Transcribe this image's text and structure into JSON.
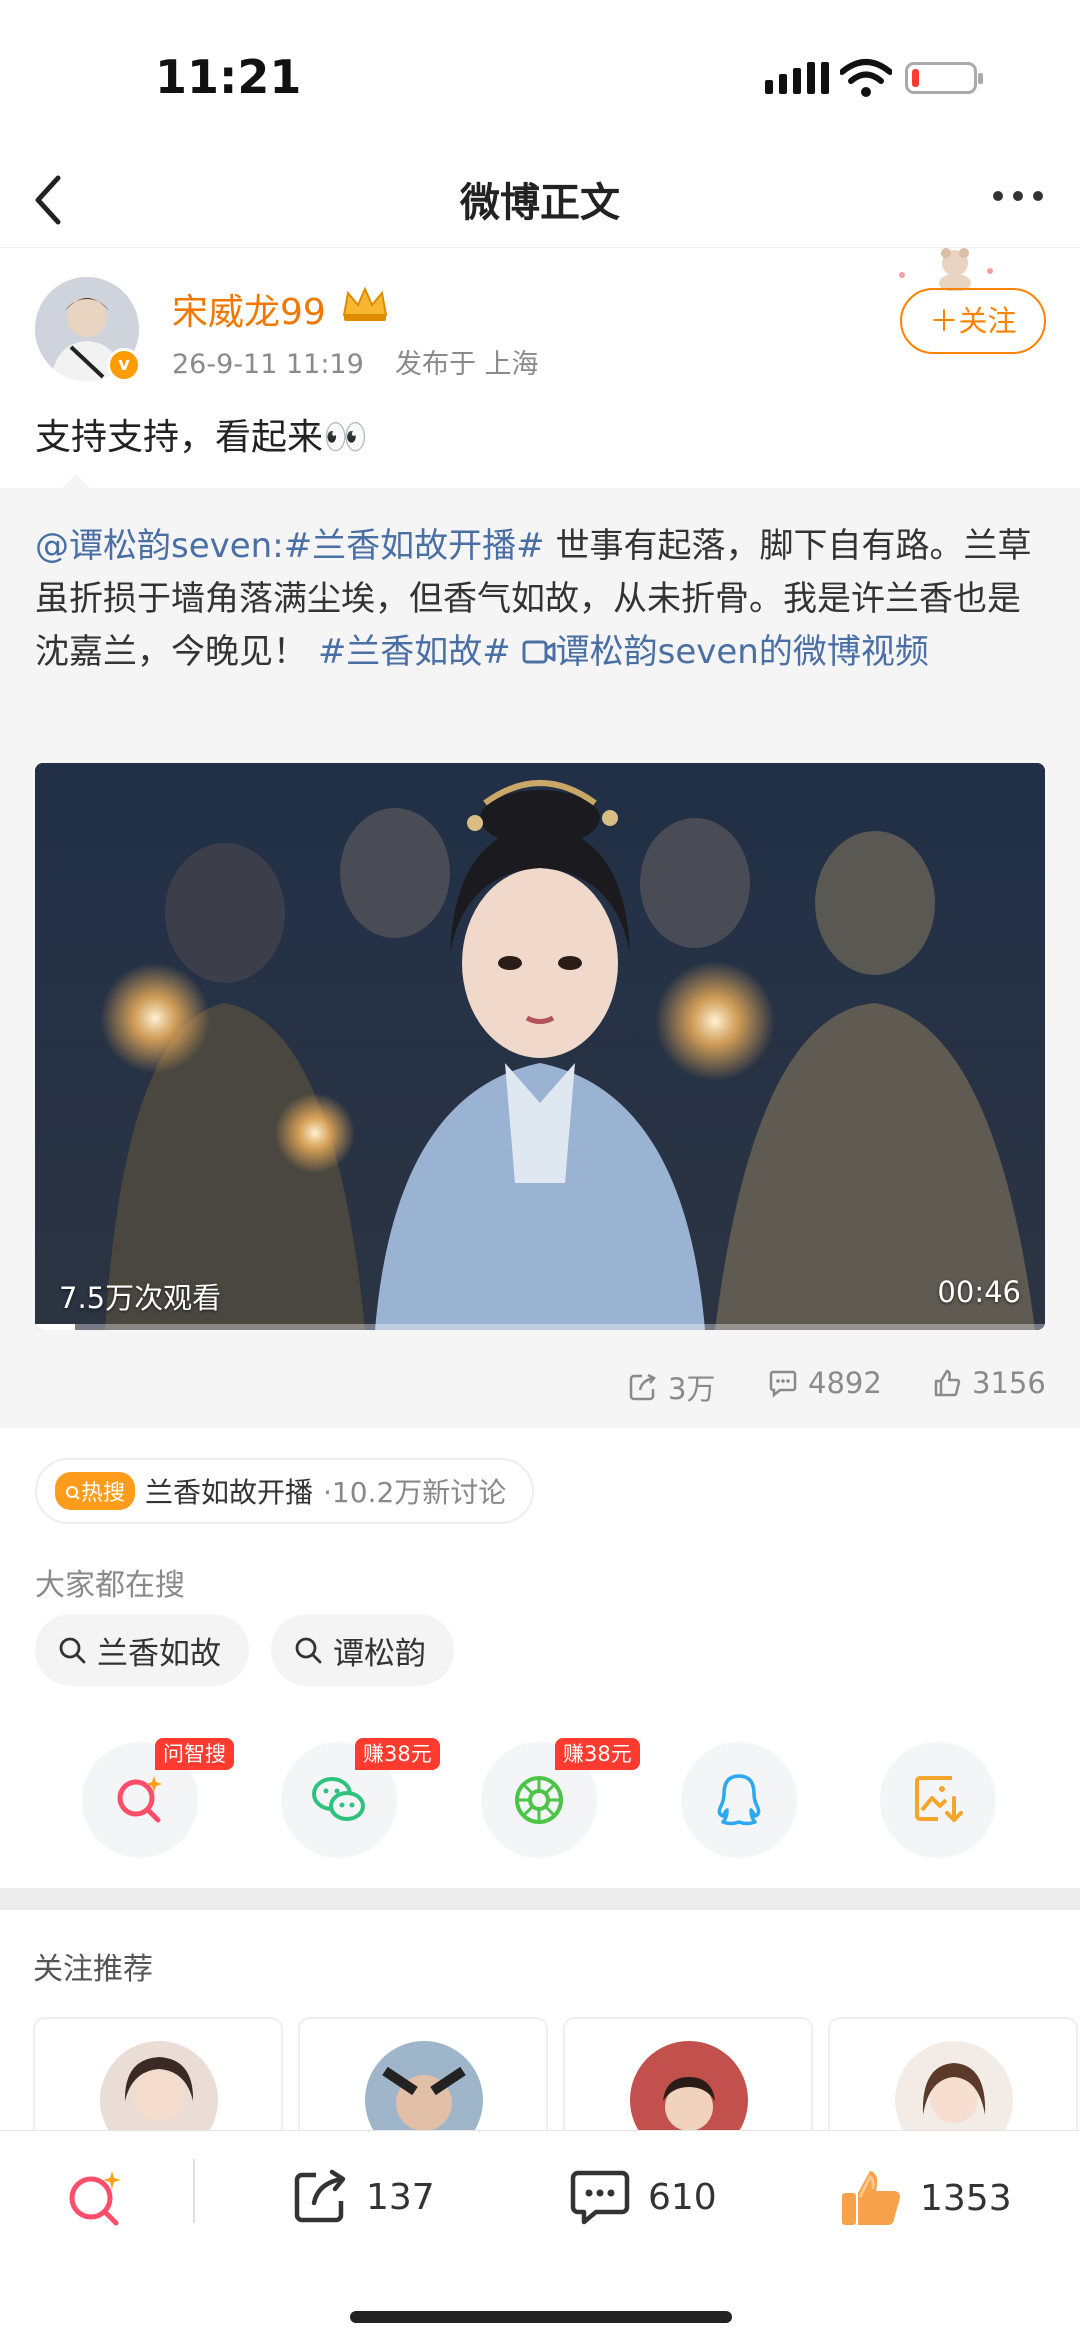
{
  "status_bar": {
    "time": "11:21",
    "battery_level": 0.12
  },
  "nav": {
    "title": "微博正文"
  },
  "post": {
    "username": "宋威龙99",
    "date": "26-9-11 11:19",
    "location": "发布于 上海",
    "follow_label": "＋关注",
    "text": "支持支持，看起来👀"
  },
  "repost": {
    "mention": "@谭松韵seven:",
    "hashtag1": "#兰香如故开播#",
    "body1": " 世事有起落，脚下自有路。兰草虽折损于墙角落满尘埃，但香气如故，从未折骨。我是许兰香也是沈嘉兰，今晚见！ ",
    "hashtag2": "#兰香如故#",
    "video_link": "谭松韵seven的微博视频",
    "video": {
      "views": "7.5万次观看",
      "duration": "00:46",
      "progress": 0.04
    },
    "stats": {
      "reposts": "3万",
      "comments": "4892",
      "likes": "3156"
    }
  },
  "hot_search": {
    "badge": "热搜",
    "topic": "兰香如故开播",
    "sub": "·10.2万新讨论"
  },
  "search": {
    "heading": "大家都在搜",
    "chips": [
      "兰香如故",
      "谭松韵"
    ]
  },
  "share": [
    {
      "icon": "ai-search-icon",
      "badge": "问智搜",
      "color": "#ff4d6a"
    },
    {
      "icon": "wechat-icon",
      "badge": "赚38元",
      "color": "#2ec27e"
    },
    {
      "icon": "moments-icon",
      "badge": "赚38元",
      "color": "#4cc447"
    },
    {
      "icon": "qq-icon",
      "badge": "",
      "color": "#2ea8f0"
    },
    {
      "icon": "save-image-icon",
      "badge": "",
      "color": "#f4a52b"
    }
  ],
  "recommend": {
    "heading": "关注推荐"
  },
  "bottom_bar": {
    "reposts": "137",
    "comments": "610",
    "likes": "1353"
  }
}
